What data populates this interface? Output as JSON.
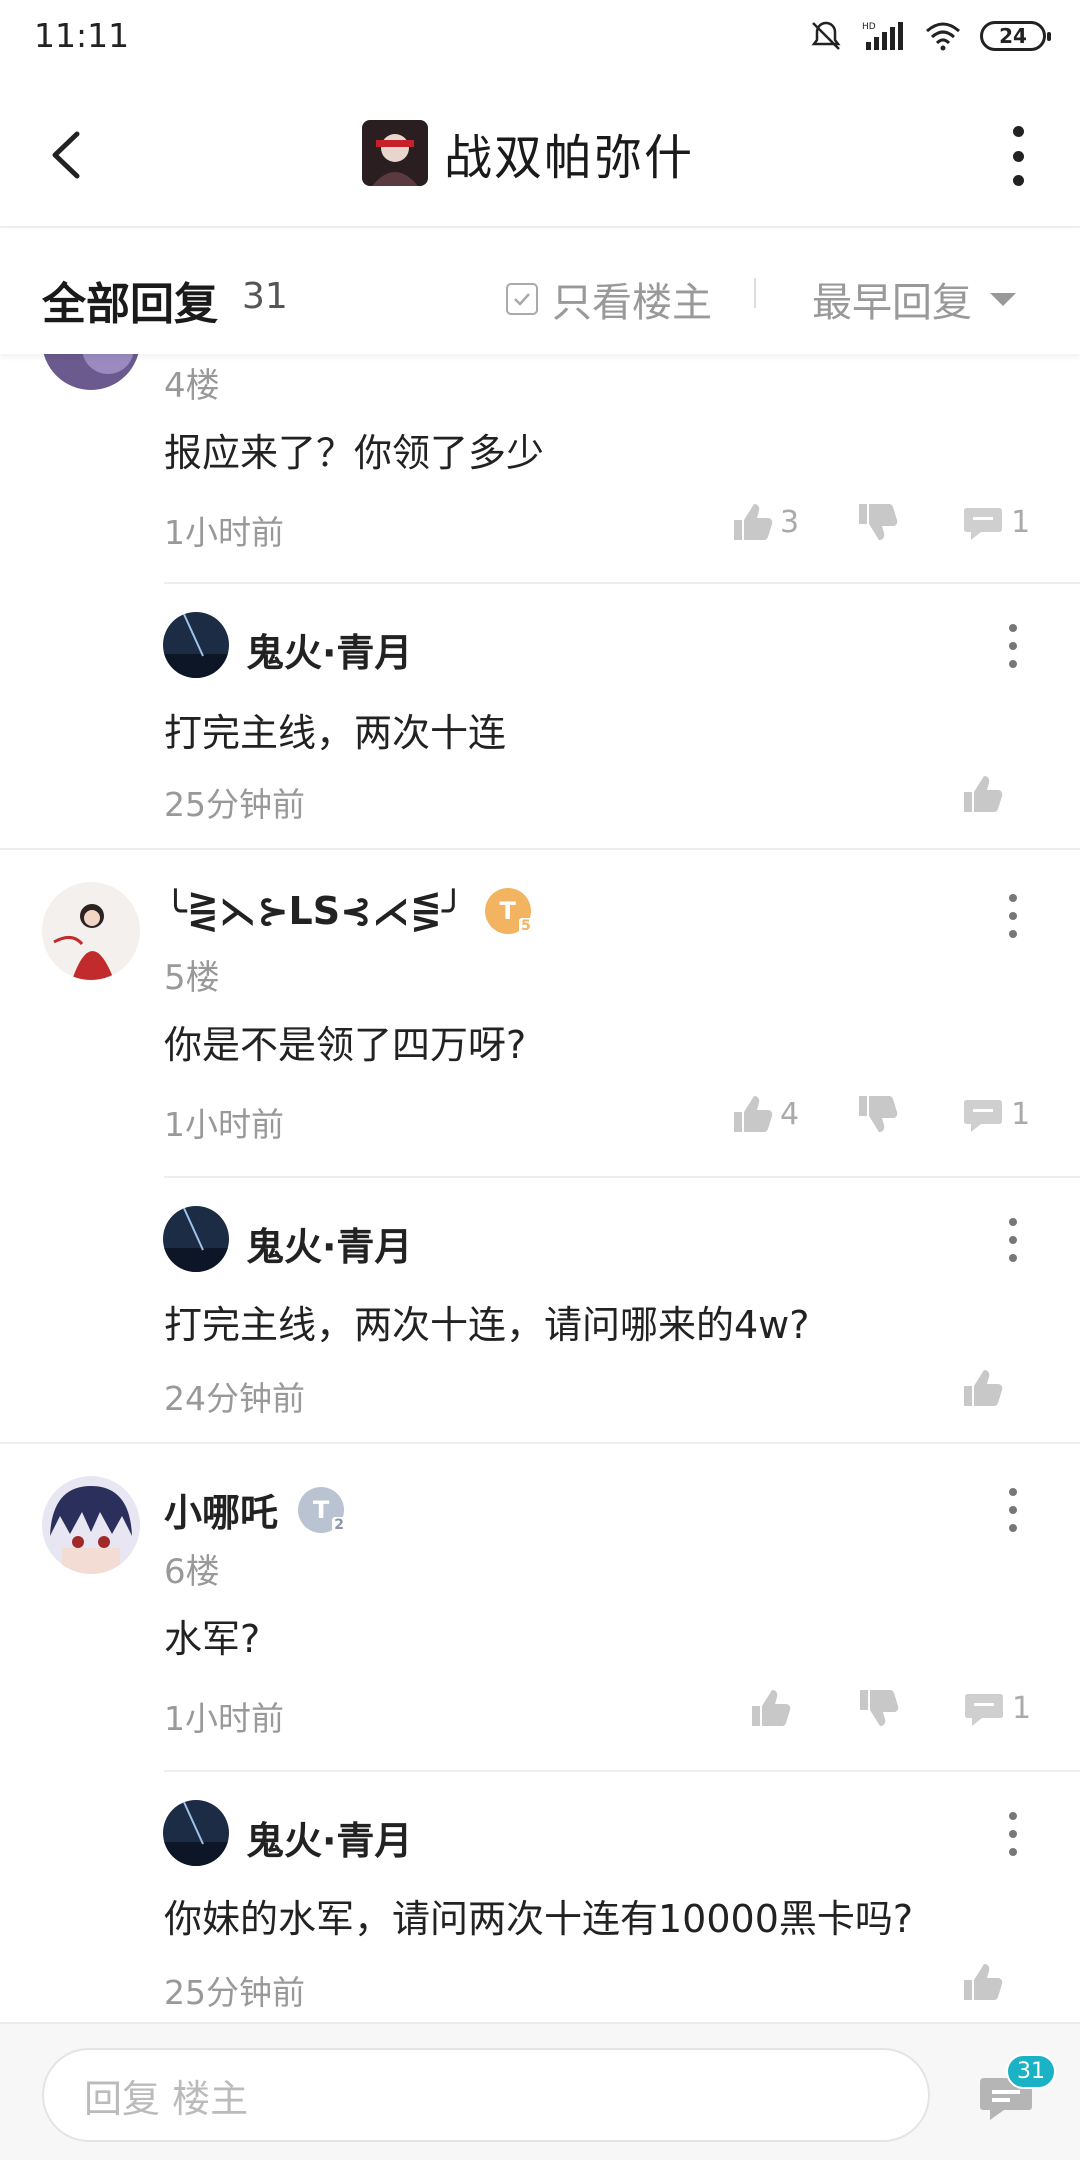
{
  "status": {
    "time": "11:11",
    "battery": "24"
  },
  "header": {
    "title": "战双帕弥什"
  },
  "filter": {
    "all_replies": "全部回复",
    "count": "31",
    "only_op": "只看楼主",
    "sort": "最早回复"
  },
  "posts": [
    {
      "floor": "4楼",
      "content": "报应来了？你领了多少",
      "time": "1小时前",
      "likes": "3",
      "comments": "1",
      "reply": {
        "name": "鬼火·青月",
        "content": "打完主线，两次十连",
        "time": "25分钟前"
      }
    },
    {
      "username": "╰⋛⋋⊱LS⊰⋌⋚╯",
      "badge": "T",
      "badge_level": "5",
      "floor": "5楼",
      "content": "你是不是领了四万呀?",
      "time": "1小时前",
      "likes": "4",
      "comments": "1",
      "reply": {
        "name": "鬼火·青月",
        "content": "打完主线，两次十连，请问哪来的4w?",
        "time": "24分钟前"
      }
    },
    {
      "username": "小哪吒",
      "badge": "T",
      "badge_level": "2",
      "floor": "6楼",
      "content": "水军?",
      "time": "1小时前",
      "comments": "1",
      "reply": {
        "name": "鬼火·青月",
        "content": "你妹的水军，请问两次十连有10000黑卡吗?",
        "time": "25分钟前"
      }
    }
  ],
  "bottom": {
    "placeholder": "回复  楼主",
    "comment_count": "31"
  },
  "colors": {
    "accent": "#1ab2c4",
    "badge_gold": "#f2b460",
    "badge_silver": "#b9c3d1"
  }
}
